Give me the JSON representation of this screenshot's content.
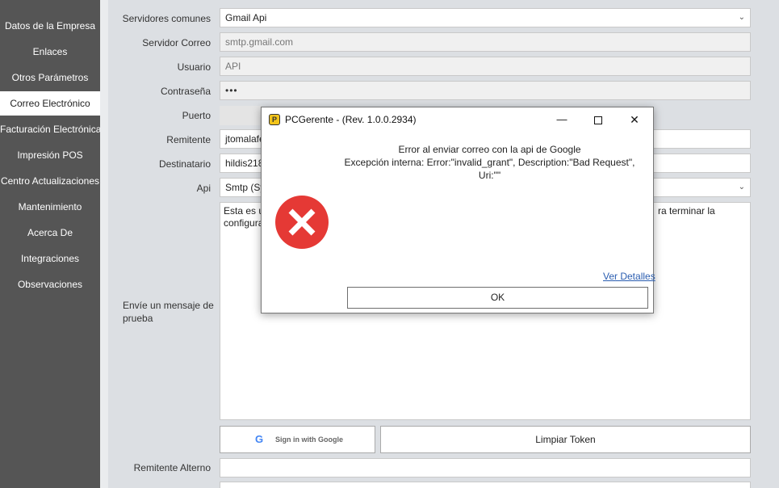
{
  "sidebar": {
    "items": [
      {
        "label": "Datos de la Empresa"
      },
      {
        "label": "Enlaces"
      },
      {
        "label": "Otros Parámetros"
      },
      {
        "label": "Correo Electrónico"
      },
      {
        "label": "Facturación Electrónica"
      },
      {
        "label": "Impresión POS"
      },
      {
        "label": "Centro Actualizaciones"
      },
      {
        "label": "Mantenimiento"
      },
      {
        "label": "Acerca De"
      },
      {
        "label": "Integraciones"
      },
      {
        "label": "Observaciones"
      }
    ]
  },
  "form": {
    "servidores_label": "Servidores comunes",
    "servidores_value": "Gmail Api",
    "servidor_correo_label": "Servidor Correo",
    "servidor_correo_value": "smtp.gmail.com",
    "usuario_label": "Usuario",
    "usuario_value": "API",
    "contrasena_label": "Contraseña",
    "contrasena_value": "•••",
    "puerto_label": "Puerto",
    "remitente_label": "Remitente",
    "remitente_value": "jtomalafe",
    "destinatario_label": "Destinatario",
    "destinatario_value": "hildis218",
    "api_label": "Api",
    "api_value": "Smtp (Sy",
    "message_label": "Envíe un mensaje de prueba",
    "message_line1": "Esta es u",
    "message_line1_tail": "ra terminar la",
    "message_line2": "configura",
    "remitente_alterno_label": "Remitente Alterno",
    "google_signin_label": "Sign in with Google",
    "limpiar_token_label": "Limpiar Token"
  },
  "dialog": {
    "title": "PCGerente - (Rev. 1.0.0.2934)",
    "message_line1": "Error al enviar correo con la api de Google",
    "message_line2": "Excepción interna: Error:\"invalid_grant\", Description:\"Bad Request\",",
    "message_line3": "Uri:\"\"",
    "details_link": "Ver Detalles",
    "ok_label": "OK"
  },
  "icons": {
    "error": "error-x-icon",
    "app": "pcgerente-app-icon",
    "google": "google-g-icon",
    "chevron": "chevron-down-icon"
  },
  "colors": {
    "sidebar_bg": "#555555",
    "error_red": "#e53935",
    "link_blue": "#2a5db0"
  }
}
